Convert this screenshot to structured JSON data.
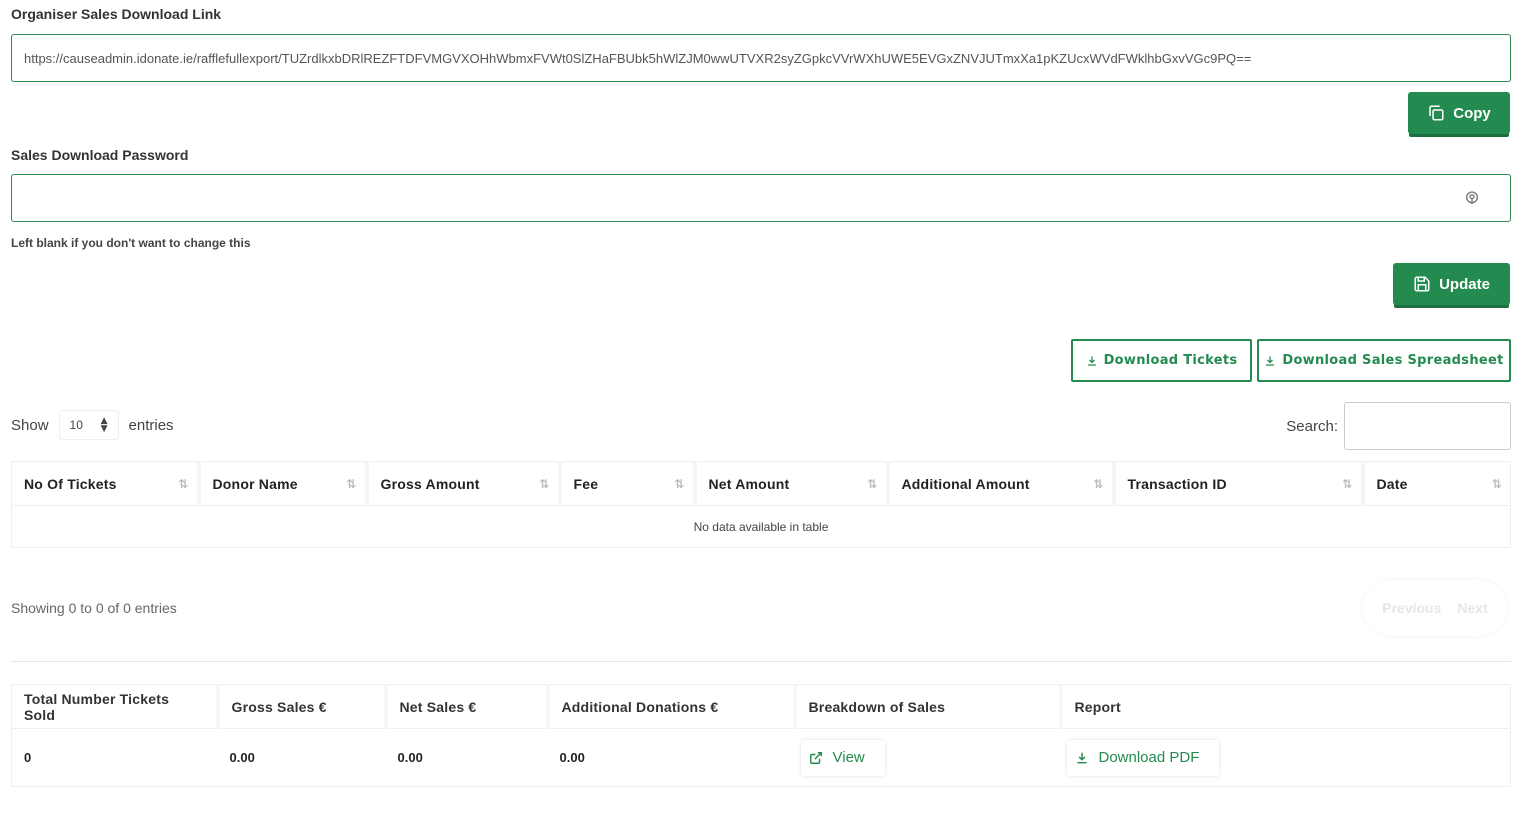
{
  "link_section": {
    "label": "Organiser Sales Download Link",
    "url": "https://causeadmin.idonate.ie/rafflefullexport/TUZrdlkxbDRlREZFTDFVMGVXOHhWbmxFVWt0SlZHaFBUbk5hWlZJM0wwUTVXR2syZGpkcVVrWXhUWE5EVGxZNVJUTmxXa1pKZUcxWVdFWklhbGxvVGc9PQ==",
    "copy_label": "Copy"
  },
  "password_section": {
    "label": "Sales Download Password",
    "hint": "Left blank if you don't want to change this",
    "update_label": "Update"
  },
  "downloads": {
    "tickets_label": "Download Tickets",
    "spreadsheet_label": "Download Sales Spreadsheet"
  },
  "table_controls": {
    "show_label": "Show",
    "entries_value": "10",
    "entries_label": "entries",
    "search_label": "Search:"
  },
  "sales_table": {
    "columns": [
      "No Of Tickets",
      "Donor Name",
      "Gross Amount",
      "Fee",
      "Net Amount",
      "Additional Amount",
      "Transaction ID",
      "Date"
    ],
    "empty_message": "No data available in table",
    "info": "Showing 0 to 0 of 0 entries",
    "previous_label": "Previous",
    "next_label": "Next"
  },
  "summary_table": {
    "columns": [
      "Total Number Tickets Sold",
      "Gross Sales €",
      "Net Sales €",
      "Additional Donations €",
      "Breakdown of Sales",
      "Report"
    ],
    "values": {
      "tickets_sold": "0",
      "gross_sales": "0.00",
      "net_sales": "0.00",
      "additional_donations": "0.00",
      "view_label": "View",
      "download_pdf_label": "Download PDF"
    }
  },
  "colors": {
    "accent": "#238b4f",
    "input_border": "#2e8b57"
  }
}
